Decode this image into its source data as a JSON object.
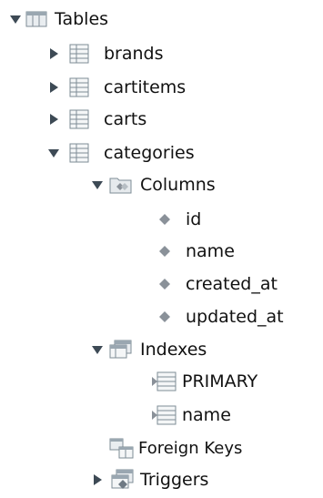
{
  "tree": {
    "tables": {
      "label": "Tables",
      "expanded": true,
      "icon": "tables-folder-icon"
    },
    "items": [
      {
        "label": "brands",
        "expanded": false,
        "icon": "table-icon"
      },
      {
        "label": "cartitems",
        "expanded": false,
        "icon": "table-icon"
      },
      {
        "label": "carts",
        "expanded": false,
        "icon": "table-icon"
      },
      {
        "label": "categories",
        "expanded": true,
        "icon": "table-icon"
      }
    ],
    "categories": {
      "columns": {
        "label": "Columns",
        "expanded": true,
        "icon": "columns-folder-icon",
        "items": [
          {
            "label": "id",
            "icon": "column-diamond-icon"
          },
          {
            "label": "name",
            "icon": "column-diamond-icon"
          },
          {
            "label": "created_at",
            "icon": "column-diamond-icon"
          },
          {
            "label": "updated_at",
            "icon": "column-diamond-icon"
          }
        ]
      },
      "indexes": {
        "label": "Indexes",
        "expanded": true,
        "icon": "indexes-folder-icon",
        "items": [
          {
            "label": "PRIMARY",
            "icon": "index-icon"
          },
          {
            "label": "name",
            "icon": "index-icon"
          }
        ]
      },
      "foreign_keys": {
        "label": "Foreign Keys",
        "icon": "foreign-keys-icon"
      },
      "triggers": {
        "label": "Triggers",
        "expanded": false,
        "icon": "triggers-icon"
      }
    }
  },
  "colors": {
    "arrow": "#3d4a55",
    "icon_grid": "#7e8c96",
    "icon_fill": "#f4f6f7",
    "diamond": "#8a9199",
    "text": "#111111"
  }
}
